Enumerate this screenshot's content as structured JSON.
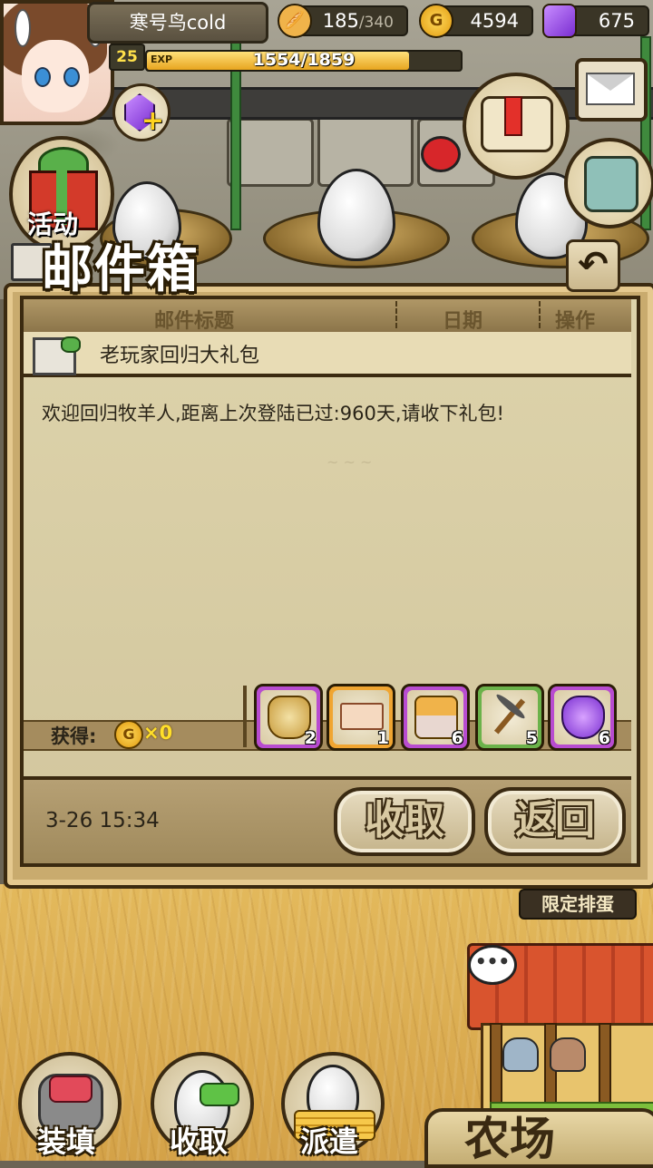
{
  "player": {
    "name": "寒号鸟cold",
    "level": "25",
    "exp_label": "EXP",
    "exp_text": "1554/1859",
    "exp_fraction": 0.836
  },
  "resources": {
    "bread": {
      "value": "185",
      "max": "/340",
      "icon": "bread-icon"
    },
    "gold": {
      "value": "4594",
      "icon": "gold-coin-icon",
      "glyph": "G"
    },
    "gem": {
      "value": "675",
      "icon": "purple-gem-icon"
    }
  },
  "event": {
    "label": "活动"
  },
  "mailbox": {
    "title": "邮件箱",
    "back_glyph": "↶",
    "columns": {
      "title": "邮件标题",
      "date": "日期",
      "action": "操作"
    },
    "selected_mail": {
      "title": "老玩家回归大礼包",
      "body": "欢迎回归牧羊人,距离上次登陆已过:960天,请收下礼包!",
      "date": "3-26 15:34"
    },
    "rewards": {
      "gain_label": "获得:",
      "coin_glyph": "G",
      "gold_amount": "×0",
      "items": [
        {
          "name": "gold-sack-icon",
          "qty": "2",
          "rarity": "purple"
        },
        {
          "name": "ticket-icon",
          "qty": "1",
          "rarity": "orange"
        },
        {
          "name": "bread-basket-icon",
          "qty": "6",
          "rarity": "purple"
        },
        {
          "name": "pickaxe-icon",
          "qty": "5",
          "rarity": "green"
        },
        {
          "name": "potion-icon",
          "qty": "6",
          "rarity": "purple"
        }
      ]
    },
    "buttons": {
      "collect": "收取",
      "return": "返回"
    }
  },
  "farm": {
    "limited_tag": "限定排蛋",
    "speech": "•••",
    "farm_label": "农场"
  },
  "bottom_nav": {
    "load": "装填",
    "collect": "收取",
    "dispatch": "派遣"
  },
  "colors": {
    "panel_frame": "#3b2a10",
    "parchment": "#ddd3ab",
    "rarity_purple": "#b84cd0",
    "rarity_orange": "#f0a531",
    "rarity_green": "#6bb24a",
    "gold_text": "#ffdf2a"
  }
}
